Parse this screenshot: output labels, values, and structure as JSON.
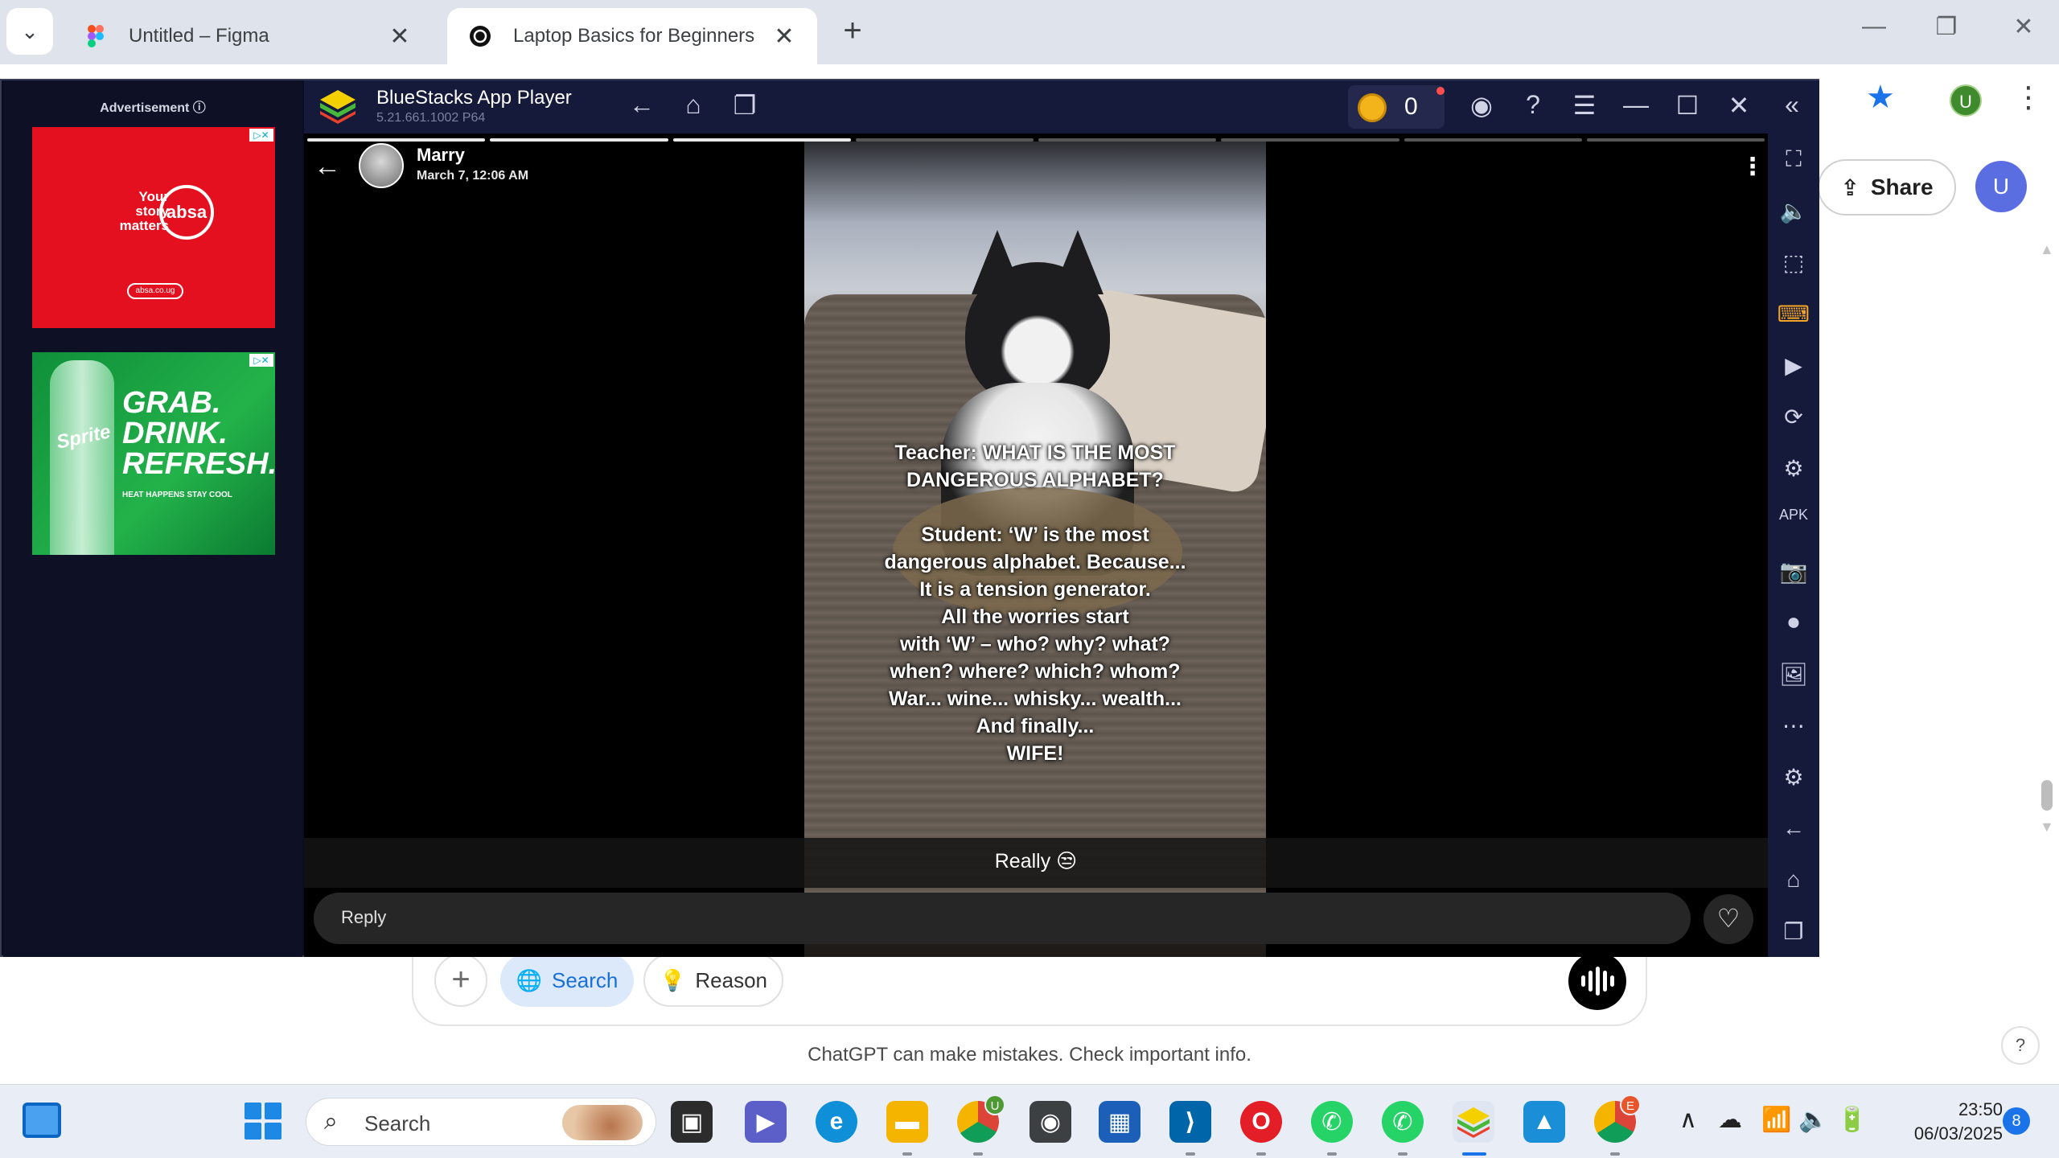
{
  "browser": {
    "tabs": [
      {
        "title": "Untitled – Figma",
        "active": false
      },
      {
        "title": "Laptop Basics for Beginners",
        "active": true
      }
    ],
    "new_tab": "+",
    "close_glyph": "✕",
    "window_controls": {
      "minimize": "—",
      "restore": "❐",
      "close": "✕"
    },
    "profile_initial": "U"
  },
  "chatgpt": {
    "share_label": "Share",
    "user_initial": "U",
    "search_label": "Search",
    "reason_label": "Reason",
    "disclaimer": "ChatGPT can make mistakes. Check important info.",
    "help_label": "?"
  },
  "bluestacks": {
    "app_name": "BlueStacks App Player",
    "version": "5.21.661.1002  P64",
    "coin_count": "0",
    "ads": {
      "label": "Advertisement ⓘ",
      "ad1": {
        "tagline": "Your story matters",
        "logo": "absa",
        "url": "absa.co.ug"
      },
      "ad2": {
        "brand": "Sprite",
        "headline": "GRAB. DRINK. REFRESH.",
        "sub": "HEAT HAPPENS STAY COOL"
      }
    },
    "story": {
      "user": "Marry",
      "timestamp": "March 7, 12:06 AM",
      "overlay_text": "Teacher: WHAT IS THE MOST\nDANGEROUS ALPHABET?\n\nStudent: ‘W’ is the most\ndangerous alphabet. Because...\nIt is a tension generator.\nAll the worries start\nwith ‘W’ – who? why? what?\nwhen? where? which? whom?\nWar... wine... whisky... wealth...\nAnd finally...\nWIFE!",
      "caption": "Really 😒",
      "reply_placeholder": "Reply",
      "progress_segments": 8,
      "completed_segments": 3
    }
  },
  "taskbar": {
    "search_label": "Search",
    "time": "23:50",
    "date": "06/03/2025",
    "notification_count": "8",
    "chrome_badge_u": "U",
    "chrome_badge_e": "E"
  },
  "colors": {
    "bluestacks_bg": "#0a0d22",
    "bluestacks_bar": "#161a3a",
    "accent_blue": "#1a73e8",
    "search_pill_bg": "#dbe9fb"
  }
}
